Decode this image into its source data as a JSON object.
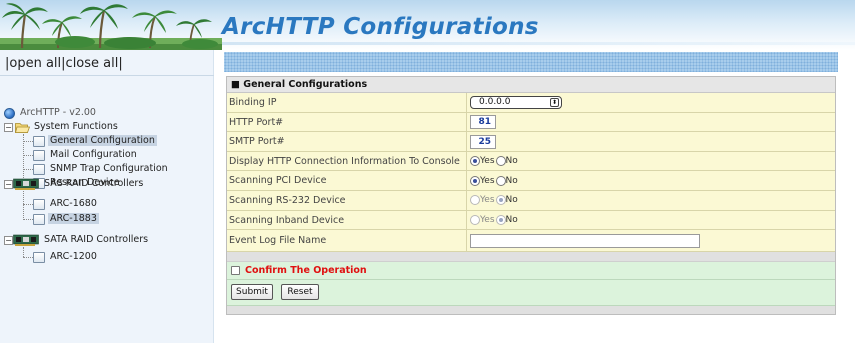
{
  "banner": {
    "title": "ArcHTTP Configurations"
  },
  "tree": {
    "open_all": "open all",
    "close_all": "close all",
    "root": "ArcHTTP - v2.00",
    "system_functions": "System Functions",
    "items": [
      "General Configuration",
      "Mail Configuration",
      "SNMP Trap Configuration",
      "Rescan Device"
    ],
    "sas": "SAS RAID Controllers",
    "sas_items": [
      "ARC-1680",
      "ARC-1883"
    ],
    "sata": "SATA RAID Controllers",
    "sata_items": [
      "ARC-1200"
    ],
    "selected": "General Configuration"
  },
  "form": {
    "header": "General Configurations",
    "binding_ip_label": "Binding IP",
    "binding_ip_value": "0.0.0.0",
    "http_port_label": "HTTP Port#",
    "http_port_value": "81",
    "smtp_port_label": "SMTP Port#",
    "smtp_port_value": "25",
    "display_info_label": "Display HTTP Connection Information To Console",
    "scan_pci_label": "Scanning PCI Device",
    "scan_rs232_label": "Scanning RS-232 Device",
    "scan_inband_label": "Scanning Inband Device",
    "event_log_label": "Event Log File Name",
    "event_log_value": "",
    "yes": "Yes",
    "no": "No",
    "confirm_label": "Confirm The Operation",
    "submit": "Submit",
    "reset": "Reset"
  },
  "colors": {
    "title_blue": "#2a78c0",
    "confirm_red": "#e01010",
    "panel_bg": "#fbf9d4",
    "confirm_bg": "#dcf3dc"
  }
}
